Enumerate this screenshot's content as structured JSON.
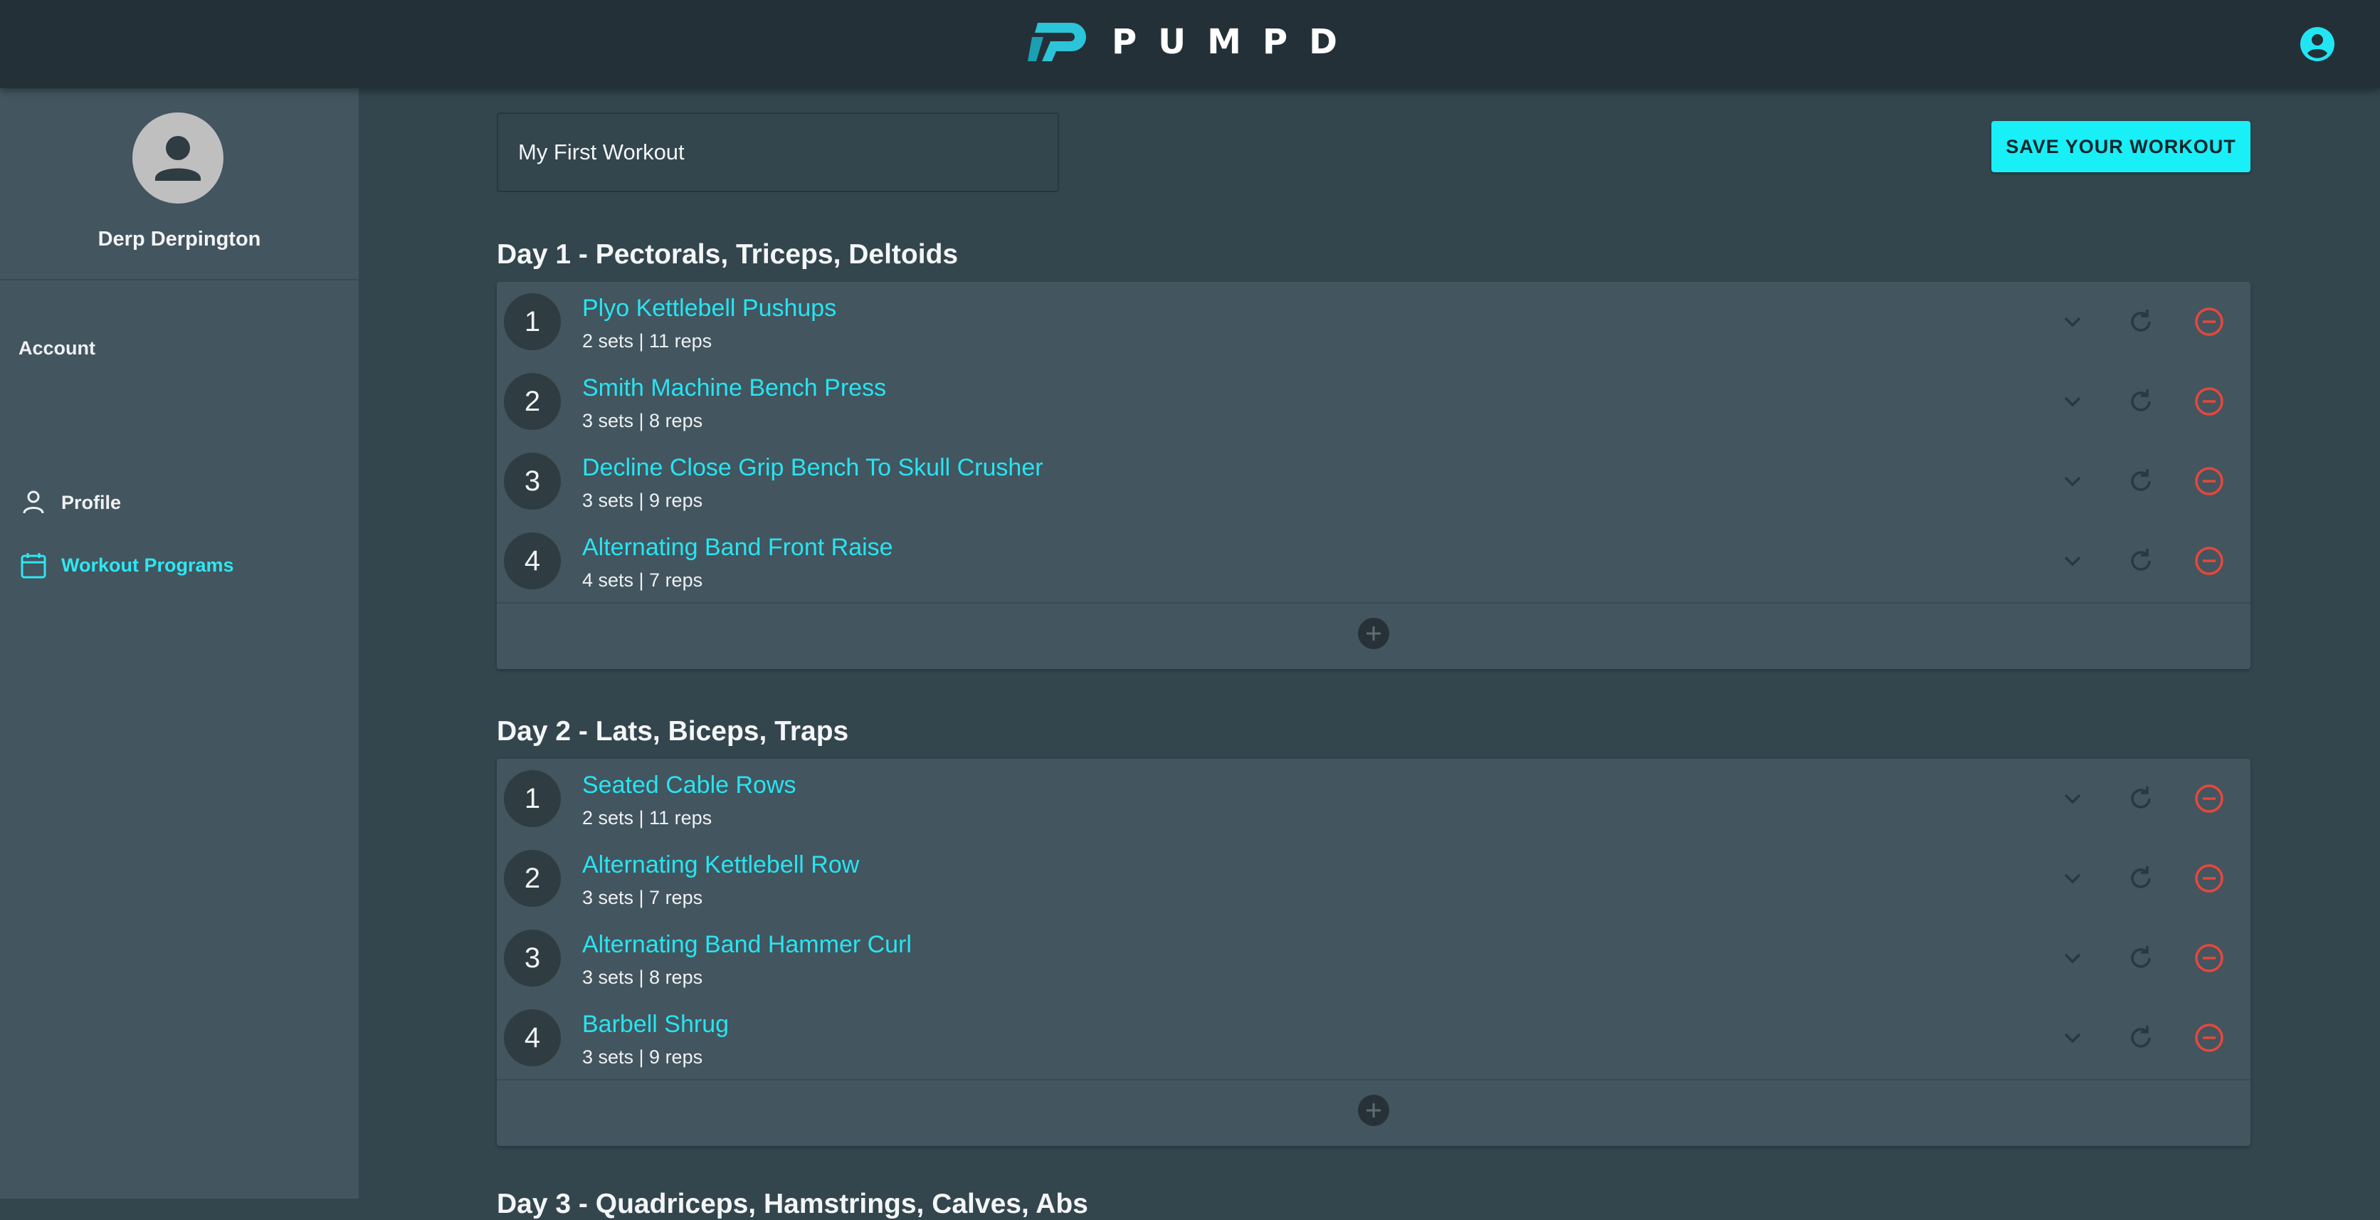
{
  "app": {
    "brand": "PUMPD",
    "accent_color": "#22e5f3",
    "danger_color": "#e8473b"
  },
  "header": {
    "account_icon": "account-circle-icon"
  },
  "sidebar": {
    "user_name": "Derp Derpington",
    "section_label": "Account",
    "items": [
      {
        "label": "Profile",
        "icon": "person-icon",
        "active": false
      },
      {
        "label": "Workout Programs",
        "icon": "calendar-icon",
        "active": true
      }
    ]
  },
  "workout": {
    "name_value": "My First Workout",
    "save_label": "SAVE YOUR WORKOUT"
  },
  "days": [
    {
      "title": "Day 1 - Pectorals, Triceps, Deltoids",
      "exercises": [
        {
          "num": "1",
          "name": "Plyo Kettlebell Pushups",
          "meta": "2 sets | 11 reps"
        },
        {
          "num": "2",
          "name": "Smith Machine Bench Press",
          "meta": "3 sets | 8 reps"
        },
        {
          "num": "3",
          "name": "Decline Close Grip Bench To Skull Crusher",
          "meta": "3 sets | 9 reps"
        },
        {
          "num": "4",
          "name": "Alternating Band Front Raise",
          "meta": "4 sets | 7 reps"
        }
      ]
    },
    {
      "title": "Day 2 - Lats, Biceps, Traps",
      "exercises": [
        {
          "num": "1",
          "name": "Seated Cable Rows",
          "meta": "2 sets | 11 reps"
        },
        {
          "num": "2",
          "name": "Alternating Kettlebell Row",
          "meta": "3 sets | 7 reps"
        },
        {
          "num": "3",
          "name": "Alternating Band Hammer Curl",
          "meta": "3 sets | 8 reps"
        },
        {
          "num": "4",
          "name": "Barbell Shrug",
          "meta": "3 sets | 9 reps"
        }
      ]
    }
  ],
  "day3_peek": "Day 3 - Quadriceps, Hamstrings, Calves, Abs"
}
